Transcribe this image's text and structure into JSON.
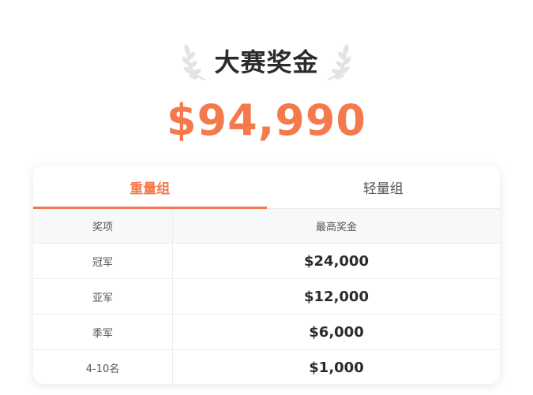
{
  "header": {
    "title": "大赛奖金",
    "total_prize": "$94,990"
  },
  "tabs": [
    {
      "label": "重量组",
      "active": true
    },
    {
      "label": "轻量组",
      "active": false
    }
  ],
  "table": {
    "columns": [
      "奖项",
      "最高奖金"
    ],
    "rows": [
      {
        "place": "冠军",
        "prize": "$24,000"
      },
      {
        "place": "亚军",
        "prize": "$12,000"
      },
      {
        "place": "季军",
        "prize": "$6,000"
      },
      {
        "place": "4-10名",
        "prize": "$1,000"
      }
    ]
  },
  "colors": {
    "accent": "#f47a4d",
    "text": "#2b2b2b",
    "laurel": "#e3e3e3"
  },
  "icons": [
    "laurel-left-icon",
    "laurel-right-icon"
  ]
}
